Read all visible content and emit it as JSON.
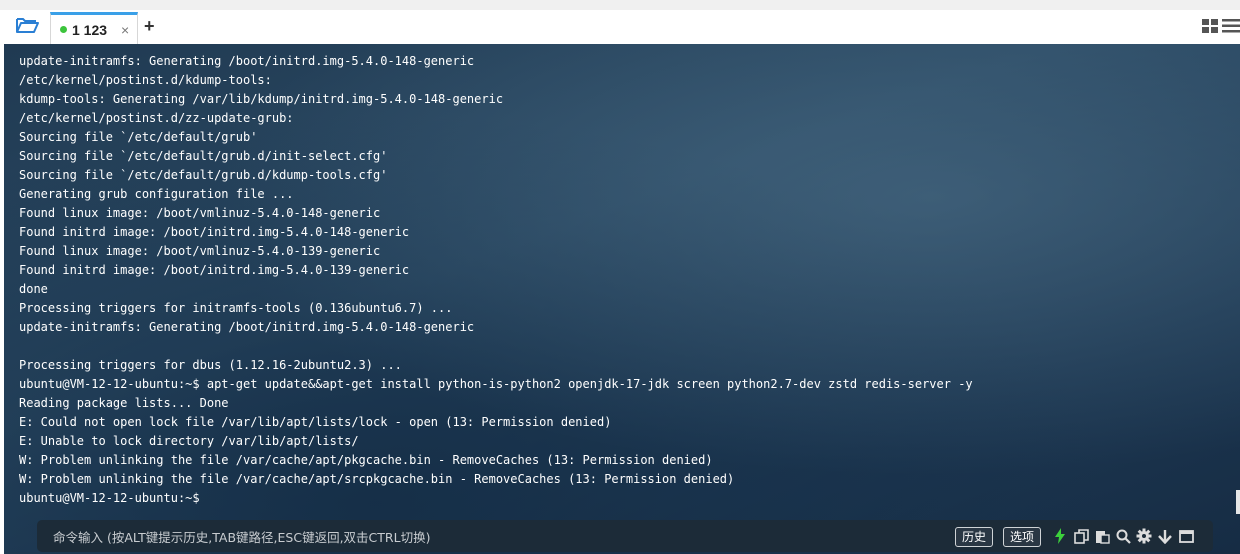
{
  "tabs": [
    {
      "label": "1 123",
      "active": true,
      "status_color": "#3cc43c",
      "close_glyph": "×"
    }
  ],
  "add_tab_glyph": "+",
  "icons": {
    "open_folder": "folder-open-icon",
    "layout": "grid-layout-icon",
    "menu": "hamburger-menu-icon"
  },
  "terminal": {
    "lines": [
      "update-initramfs: Generating /boot/initrd.img-5.4.0-148-generic",
      "/etc/kernel/postinst.d/kdump-tools:",
      "kdump-tools: Generating /var/lib/kdump/initrd.img-5.4.0-148-generic",
      "/etc/kernel/postinst.d/zz-update-grub:",
      "Sourcing file `/etc/default/grub'",
      "Sourcing file `/etc/default/grub.d/init-select.cfg'",
      "Sourcing file `/etc/default/grub.d/kdump-tools.cfg'",
      "Generating grub configuration file ...",
      "Found linux image: /boot/vmlinuz-5.4.0-148-generic",
      "Found initrd image: /boot/initrd.img-5.4.0-148-generic",
      "Found linux image: /boot/vmlinuz-5.4.0-139-generic",
      "Found initrd image: /boot/initrd.img-5.4.0-139-generic",
      "done",
      "Processing triggers for initramfs-tools (0.136ubuntu6.7) ...",
      "update-initramfs: Generating /boot/initrd.img-5.4.0-148-generic",
      "",
      "Processing triggers for dbus (1.12.16-2ubuntu2.3) ...",
      "ubuntu@VM-12-12-ubuntu:~$ apt-get update&&apt-get install python-is-python2 openjdk-17-jdk screen python2.7-dev zstd redis-server -y",
      "Reading package lists... Done",
      "E: Could not open lock file /var/lib/apt/lists/lock - open (13: Permission denied)",
      "E: Unable to lock directory /var/lib/apt/lists/",
      "W: Problem unlinking the file /var/cache/apt/pkgcache.bin - RemoveCaches (13: Permission denied)",
      "W: Problem unlinking the file /var/cache/apt/srcpkgcache.bin - RemoveCaches (13: Permission denied)",
      "ubuntu@VM-12-12-ubuntu:~$"
    ]
  },
  "command_bar": {
    "placeholder": "命令输入 (按ALT键提示历史,TAB键路径,ESC键返回,双击CTRL切换)",
    "history_label": "历史",
    "options_label": "选项",
    "tool_icons": [
      "lightning-icon",
      "copy-icon",
      "paste-icon",
      "search-icon",
      "gear-icon",
      "download-arrow-icon",
      "maximize-icon"
    ],
    "lightning_color": "#3cd13c"
  }
}
